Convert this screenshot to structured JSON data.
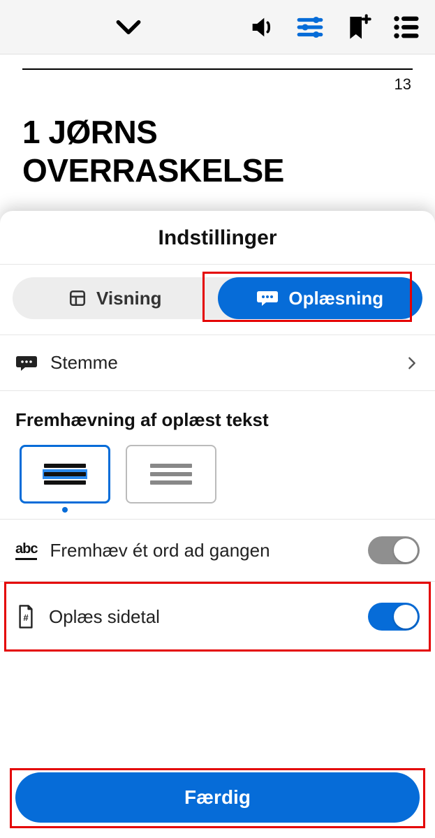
{
  "colors": {
    "accent": "#066cd8",
    "highlight": "#e40000"
  },
  "page": {
    "number": "13",
    "chapter_title": "1 JØRNS OVERRASKELSE"
  },
  "sheet": {
    "title": "Indstillinger",
    "tabs": {
      "display": "Visning",
      "tts": "Oplæsning"
    },
    "voice_label": "Stemme",
    "highlight_section": "Fremhævning af oplæst tekst",
    "word_highlight_label": "Fremhæv ét ord ad gangen",
    "read_pagenum_label": "Oplæs sidetal",
    "done_label": "Færdig"
  }
}
